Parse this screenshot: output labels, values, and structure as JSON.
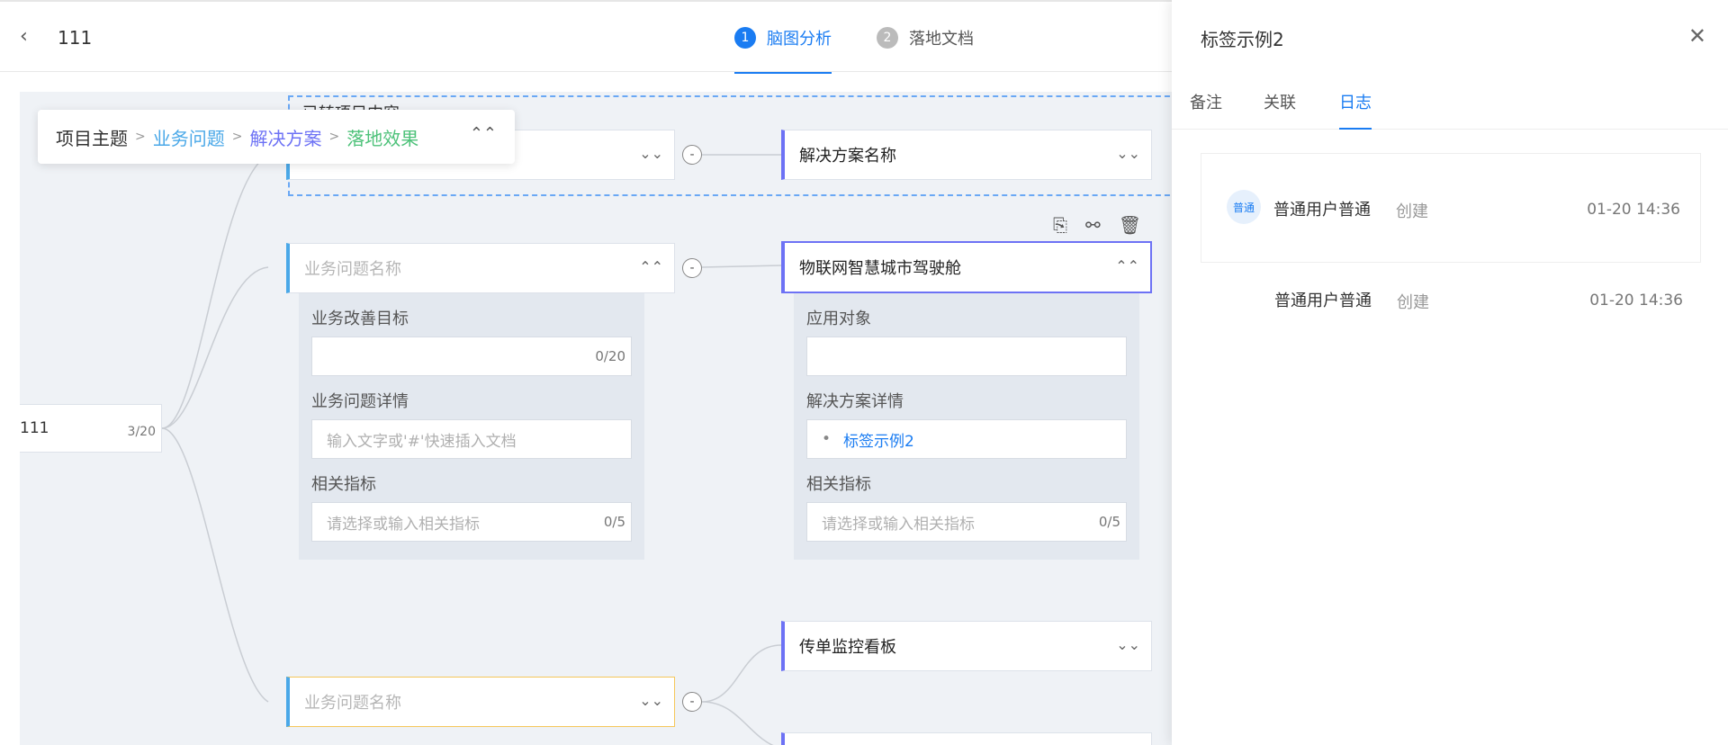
{
  "header": {
    "back_icon": "chevron-left-icon",
    "title": "111",
    "steps": [
      {
        "num": "1",
        "label": "脑图分析",
        "active": true
      },
      {
        "num": "2",
        "label": "落地文档",
        "active": false
      }
    ]
  },
  "breadcrumb": {
    "items": [
      "项目主题",
      "业务问题",
      "解决方案",
      "落地效果"
    ],
    "separator": ">",
    "colors": [
      "#333333",
      "#4aa8e8",
      "#6d72f5",
      "#4ec27a"
    ]
  },
  "canvas": {
    "root": {
      "label": "111",
      "count": "3/20"
    },
    "group_label": "已转项目内容",
    "solution_top": "解决方案名称",
    "problem_placeholder": "业务问题名称",
    "problem_detail": {
      "goal_label": "业务改善目标",
      "goal_count": "0/20",
      "details_label": "业务问题详情",
      "details_placeholder": "输入文字或'#'快速插入文档",
      "metric_label": "相关指标",
      "metric_placeholder": "请选择或输入相关指标",
      "metric_count": "0/5"
    },
    "solution_selected": "物联网智慧城市驾驶舱",
    "solution_detail": {
      "target_label": "应用对象",
      "details_label": "解决方案详情",
      "tag": "标签示例2",
      "metric_label": "相关指标",
      "metric_placeholder": "请选择或输入相关指标",
      "metric_count": "0/5"
    },
    "solution_bottom": "传单监控看板",
    "problem_bottom_placeholder": "业务问题名称",
    "collapse_symbol": "-"
  },
  "panel": {
    "title": "标签示例2",
    "tabs": [
      {
        "label": "备注",
        "active": false
      },
      {
        "label": "关联",
        "active": false
      },
      {
        "label": "日志",
        "active": true
      }
    ],
    "logs": [
      {
        "avatar": "普通",
        "user": "普通用户普通",
        "action": "创建",
        "time": "01-20 14:36"
      },
      {
        "user": "普通用户普通",
        "action": "创建",
        "time": "01-20 14:36"
      }
    ]
  },
  "colors": {
    "accent": "#1a7cf2",
    "problem": "#4aa8e8",
    "solution": "#6d72f5",
    "effect": "#4ec27a"
  }
}
